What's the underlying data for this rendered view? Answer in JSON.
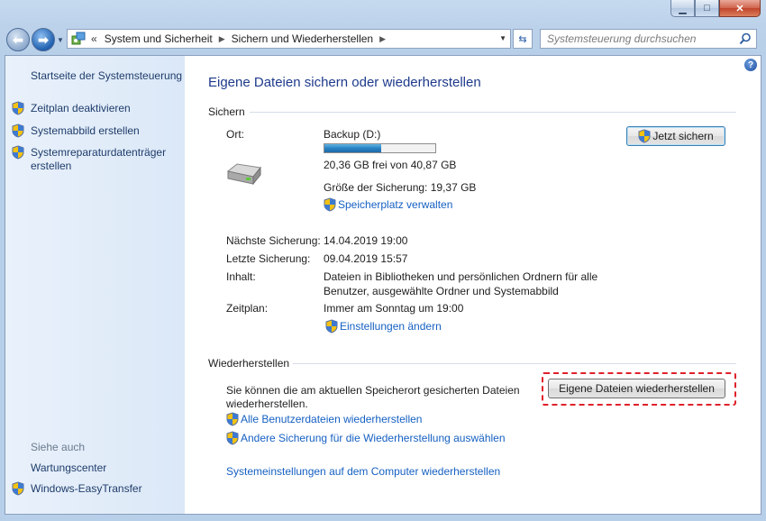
{
  "window": {
    "caption_buttons": {
      "minimize": "minimize-icon",
      "maximize": "maximize-icon",
      "close": "close-icon"
    }
  },
  "navbar": {
    "breadcrumb_sep": "«",
    "crumbs": [
      "System und Sicherheit",
      "Sichern und Wiederherstellen"
    ],
    "search_placeholder": "Systemsteuerung durchsuchen"
  },
  "sidebar": {
    "home": "Startseite der Systemsteuerung",
    "items": [
      {
        "label": "Zeitplan deaktivieren",
        "icon": "uac-shield-icon"
      },
      {
        "label": "Systemabbild erstellen",
        "icon": "uac-shield-icon"
      },
      {
        "label": "Systemreparaturdatenträger erstellen",
        "icon": "uac-shield-icon"
      }
    ],
    "see_also_heading": "Siehe auch",
    "see_also": [
      {
        "label": "Wartungscenter"
      },
      {
        "label": "Windows-EasyTransfer",
        "icon": "uac-shield-icon"
      }
    ]
  },
  "main": {
    "title": "Eigene Dateien sichern oder wiederherstellen",
    "backup": {
      "heading": "Sichern",
      "location_label": "Ort:",
      "location_value": "Backup (D:)",
      "drive_fill_fraction": 0.51,
      "free_space": "20,36 GB frei von 40,87 GB",
      "backup_size": "Größe der Sicherung: 19,37 GB",
      "manage_space_link": "Speicherplatz verwalten",
      "backup_now_button": "Jetzt sichern",
      "next_label": "Nächste Sicherung:",
      "next_value": "14.04.2019 19:00",
      "last_label": "Letzte Sicherung:",
      "last_value": "09.04.2019 15:57",
      "content_label": "Inhalt:",
      "content_value_line1": "Dateien in Bibliotheken und persönlichen Ordnern für alle",
      "content_value_line2": "Benutzer, ausgewählte Ordner und Systemabbild",
      "schedule_label": "Zeitplan:",
      "schedule_value": "Immer am Sonntag um 19:00",
      "change_settings_link": "Einstellungen ändern"
    },
    "restore": {
      "heading": "Wiederherstellen",
      "desc_line1": "Sie können die am aktuellen Speicherort gesicherten Dateien",
      "desc_line2": "wiederherstellen.",
      "restore_button": "Eigene Dateien wiederherstellen",
      "all_users_link": "Alle Benutzerdateien wiederherstellen",
      "other_backup_link": "Andere Sicherung für die Wiederherstellung auswählen",
      "system_settings_link": "Systemeinstellungen auf dem Computer wiederherstellen"
    }
  },
  "colors": {
    "accent_link": "#1560c2",
    "title": "#1e3a8c",
    "highlight": "#e0202a"
  }
}
